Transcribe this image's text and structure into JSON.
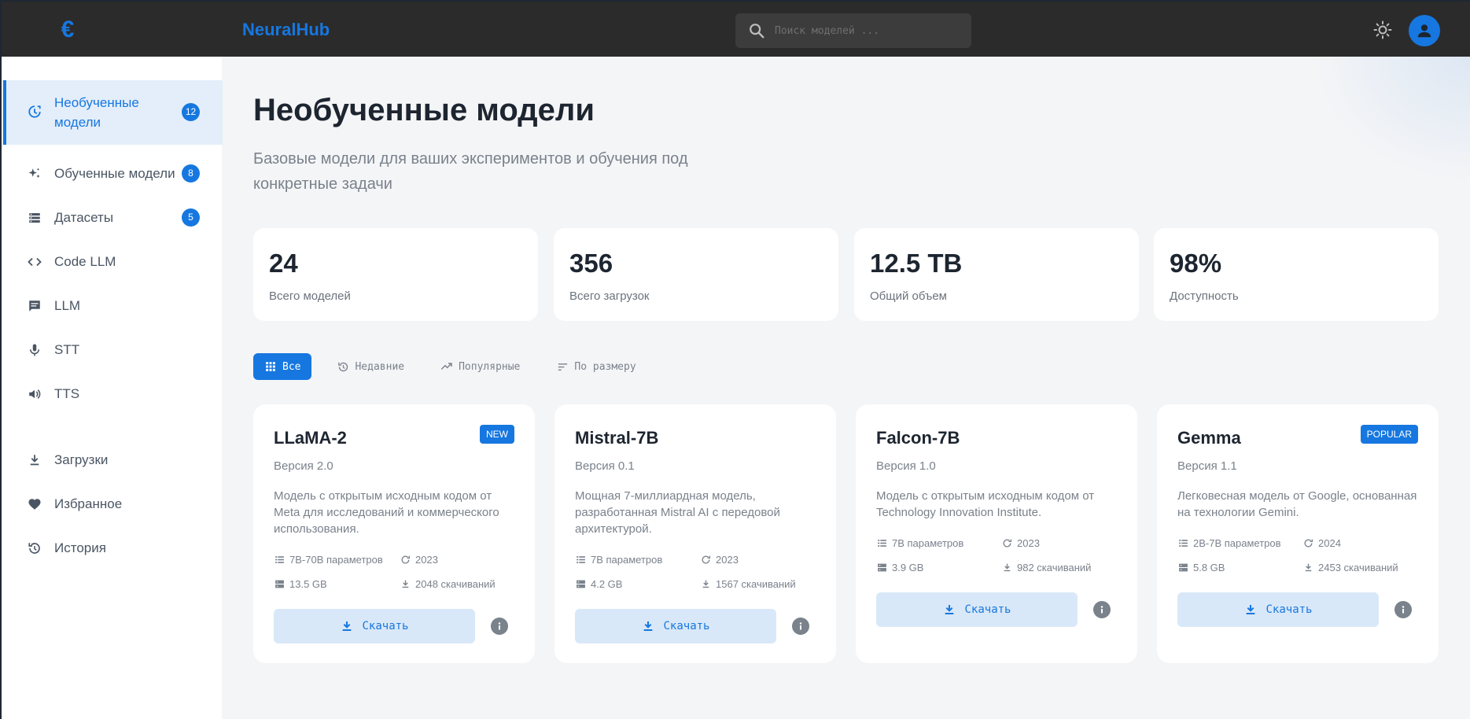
{
  "header": {
    "logo_glyph": "€",
    "brand": "NeuralHub",
    "search_placeholder": "Поиск моделей ...",
    "accent": "#1677e0"
  },
  "sidebar": {
    "items": [
      {
        "label": "Необученные модели",
        "icon": "model-training-icon",
        "badge": "12",
        "active": true
      },
      {
        "label": "Обученные модели",
        "icon": "sparkles-icon",
        "badge": "8"
      },
      {
        "label": "Датасеты",
        "icon": "storage-icon",
        "badge": "5"
      },
      {
        "label": "Code LLM",
        "icon": "code-icon"
      },
      {
        "label": "LLM",
        "icon": "chat-icon"
      },
      {
        "label": "STT",
        "icon": "microphone-icon"
      },
      {
        "label": "TTS",
        "icon": "volume-icon"
      },
      {
        "label": "Загрузки",
        "icon": "download-icon"
      },
      {
        "label": "Избранное",
        "icon": "heart-icon"
      },
      {
        "label": "История",
        "icon": "history-icon"
      }
    ]
  },
  "main": {
    "title": "Необученные модели",
    "subtitle": "Базовые модели для ваших экспериментов и обучения под конкретные задачи",
    "stats": [
      {
        "value": "24",
        "caption": "Всего моделей"
      },
      {
        "value": "356",
        "caption": "Всего загрузок"
      },
      {
        "value": "12.5 TB",
        "caption": "Общий объем"
      },
      {
        "value": "98%",
        "caption": "Доступность"
      }
    ],
    "filters": [
      {
        "label": "Все",
        "icon": "grid-icon",
        "active": true
      },
      {
        "label": "Недавние",
        "icon": "history-icon"
      },
      {
        "label": "Популярные",
        "icon": "trending-icon"
      },
      {
        "label": "По размеру",
        "icon": "sort-icon"
      }
    ],
    "models": [
      {
        "name": "LLaMA-2",
        "tag": "NEW",
        "version": "Версия 2.0",
        "description": "Модель с открытым исходным кодом от Meta для исследований и коммерческого использования.",
        "params": "7B-70B параметров",
        "year": "2023",
        "size": "13.5 GB",
        "downloads": "2048 скачиваний",
        "download_label": "Скачать"
      },
      {
        "name": "Mistral-7B",
        "tag": "",
        "version": "Версия 0.1",
        "description": "Мощная 7-миллиардная модель, разработанная Mistral AI с передовой архитектурой.",
        "params": "7B параметров",
        "year": "2023",
        "size": "4.2 GB",
        "downloads": "1567 скачиваний",
        "download_label": "Скачать"
      },
      {
        "name": "Falcon-7B",
        "tag": "",
        "version": "Версия 1.0",
        "description": "Модель с открытым исходным кодом от Technology Innovation Institute.",
        "params": "7B параметров",
        "year": "2023",
        "size": "3.9 GB",
        "downloads": "982 скачиваний",
        "download_label": "Скачать"
      },
      {
        "name": "Gemma",
        "tag": "POPULAR",
        "version": "Версия 1.1",
        "description": "Легковесная модель от Google, основанная на технологии Gemini.",
        "params": "2B-7B параметров",
        "year": "2024",
        "size": "5.8 GB",
        "downloads": "2453 скачиваний",
        "download_label": "Скачать"
      }
    ]
  }
}
